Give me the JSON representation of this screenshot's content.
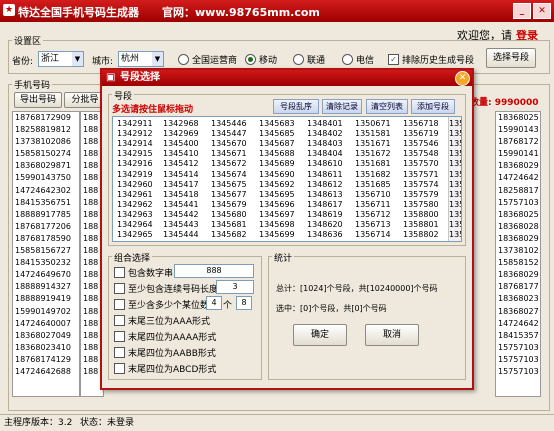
{
  "app": {
    "title": "特达全国手机号码生成器",
    "website": "官网：www.98765mm.com"
  },
  "header": {
    "welcome": "欢迎您，请",
    "login": "登录"
  },
  "settings": {
    "group_label": "设置区",
    "province_label": "省份:",
    "province_value": "浙江",
    "city_label": "城市:",
    "city_value": "杭州",
    "operators": [
      "全国运营商",
      "移动",
      "联通",
      "电信"
    ],
    "operator_selected": 1,
    "exclude_history": "排除历史生成号段",
    "select_segment": "选择号段"
  },
  "phone_section": {
    "label": "手机号码",
    "export_button": "导出号码",
    "batch_button": "分批导",
    "count_text": "数量: 9990000",
    "left_column": [
      "18768172909",
      "18258819812",
      "13738102086",
      "15858150274",
      "18368029871",
      "15990143750",
      "14724642302",
      "18415356751",
      "18888917785",
      "18768177206",
      "18768178590",
      "15858156727",
      "18415350232",
      "14724649670",
      "18888914327",
      "18888919419",
      "15990149702",
      "14724640007",
      "18368027049",
      "18368023410",
      "18768174129",
      "14724642688"
    ],
    "mid_column": [
      "188",
      "188",
      "188",
      "188",
      "188",
      "188",
      "188",
      "188",
      "188",
      "188",
      "188",
      "188",
      "188",
      "188",
      "188",
      "188",
      "188",
      "188",
      "188",
      "188",
      "188",
      "188"
    ],
    "right_column": [
      "18368025",
      "15990143",
      "18768172",
      "15990141",
      "18368029",
      "14724642",
      "18258817",
      "15757103",
      "18368025",
      "18368028",
      "18368029",
      "13738102",
      "15858152",
      "18368029",
      "18768177",
      "18368023",
      "18368027",
      "14724642",
      "18415357",
      "15757103",
      "15757103",
      "15757103"
    ]
  },
  "dialog": {
    "title": "号段选择",
    "group_label": "号段",
    "hint": "多选请按住鼠标拖动",
    "buttons": [
      "号段乱序",
      "清除记录",
      "清空列表",
      "添加号段"
    ],
    "segments": [
      [
        "1342911",
        "1342912",
        "1342914",
        "1342915",
        "1342916",
        "1342919",
        "1342960",
        "1342961",
        "1342962",
        "1342963",
        "1342964",
        "1342965"
      ],
      [
        "1342968",
        "1342969",
        "1345400",
        "1345410",
        "1345412",
        "1345414",
        "1345417",
        "1345418",
        "1345441",
        "1345442",
        "1345443",
        "1345444"
      ],
      [
        "1345446",
        "1345447",
        "1345670",
        "1345671",
        "1345672",
        "1345674",
        "1345675",
        "1345677",
        "1345679",
        "1345680",
        "1345681",
        "1345682"
      ],
      [
        "1345683",
        "1345685",
        "1345687",
        "1345688",
        "1345689",
        "1345690",
        "1345692",
        "1345695",
        "1345696",
        "1345697",
        "1345698",
        "1345699"
      ],
      [
        "1348401",
        "1348402",
        "1348403",
        "1348404",
        "1348610",
        "1348611",
        "1348612",
        "1348613",
        "1348617",
        "1348619",
        "1348620",
        "1348636"
      ],
      [
        "1350671",
        "1351581",
        "1351671",
        "1351672",
        "1351681",
        "1351682",
        "1351685",
        "1356710",
        "1356711",
        "1356712",
        "1356713",
        "1356714"
      ],
      [
        "1356718",
        "1356719",
        "1357546",
        "1357548",
        "1357570",
        "1357571",
        "1357574",
        "1357579",
        "1357580",
        "1358800",
        "1358801",
        "1358802"
      ],
      [
        "135",
        "135",
        "135",
        "135",
        "135",
        "135",
        "135",
        "135",
        "135",
        "135",
        "135",
        "135"
      ]
    ],
    "combo": {
      "label": "组合选择",
      "contains_string_label": "包含数字串",
      "contains_string_value": "888",
      "consecutive_label": "至少包含连续号码长度",
      "consecutive_value": "3",
      "min_count_label": "至少含多少个某位数",
      "min_count_value": "4",
      "min_count_unit": "个",
      "min_count_digit": "8",
      "options": [
        "末尾三位为AAA形式",
        "末尾四位为AAAA形式",
        "末尾四位为AABB形式",
        "末尾四位为ABCD形式"
      ]
    },
    "stats": {
      "label": "统计",
      "total": "总计：[1024]个号段，共[10240000]个号码",
      "selected": "选中：[0]个号段，共[0]个号码",
      "ok": "确定",
      "cancel": "取消"
    }
  },
  "statusbar": {
    "version": "主程序版本：3.2",
    "state": "状态：未登录"
  }
}
